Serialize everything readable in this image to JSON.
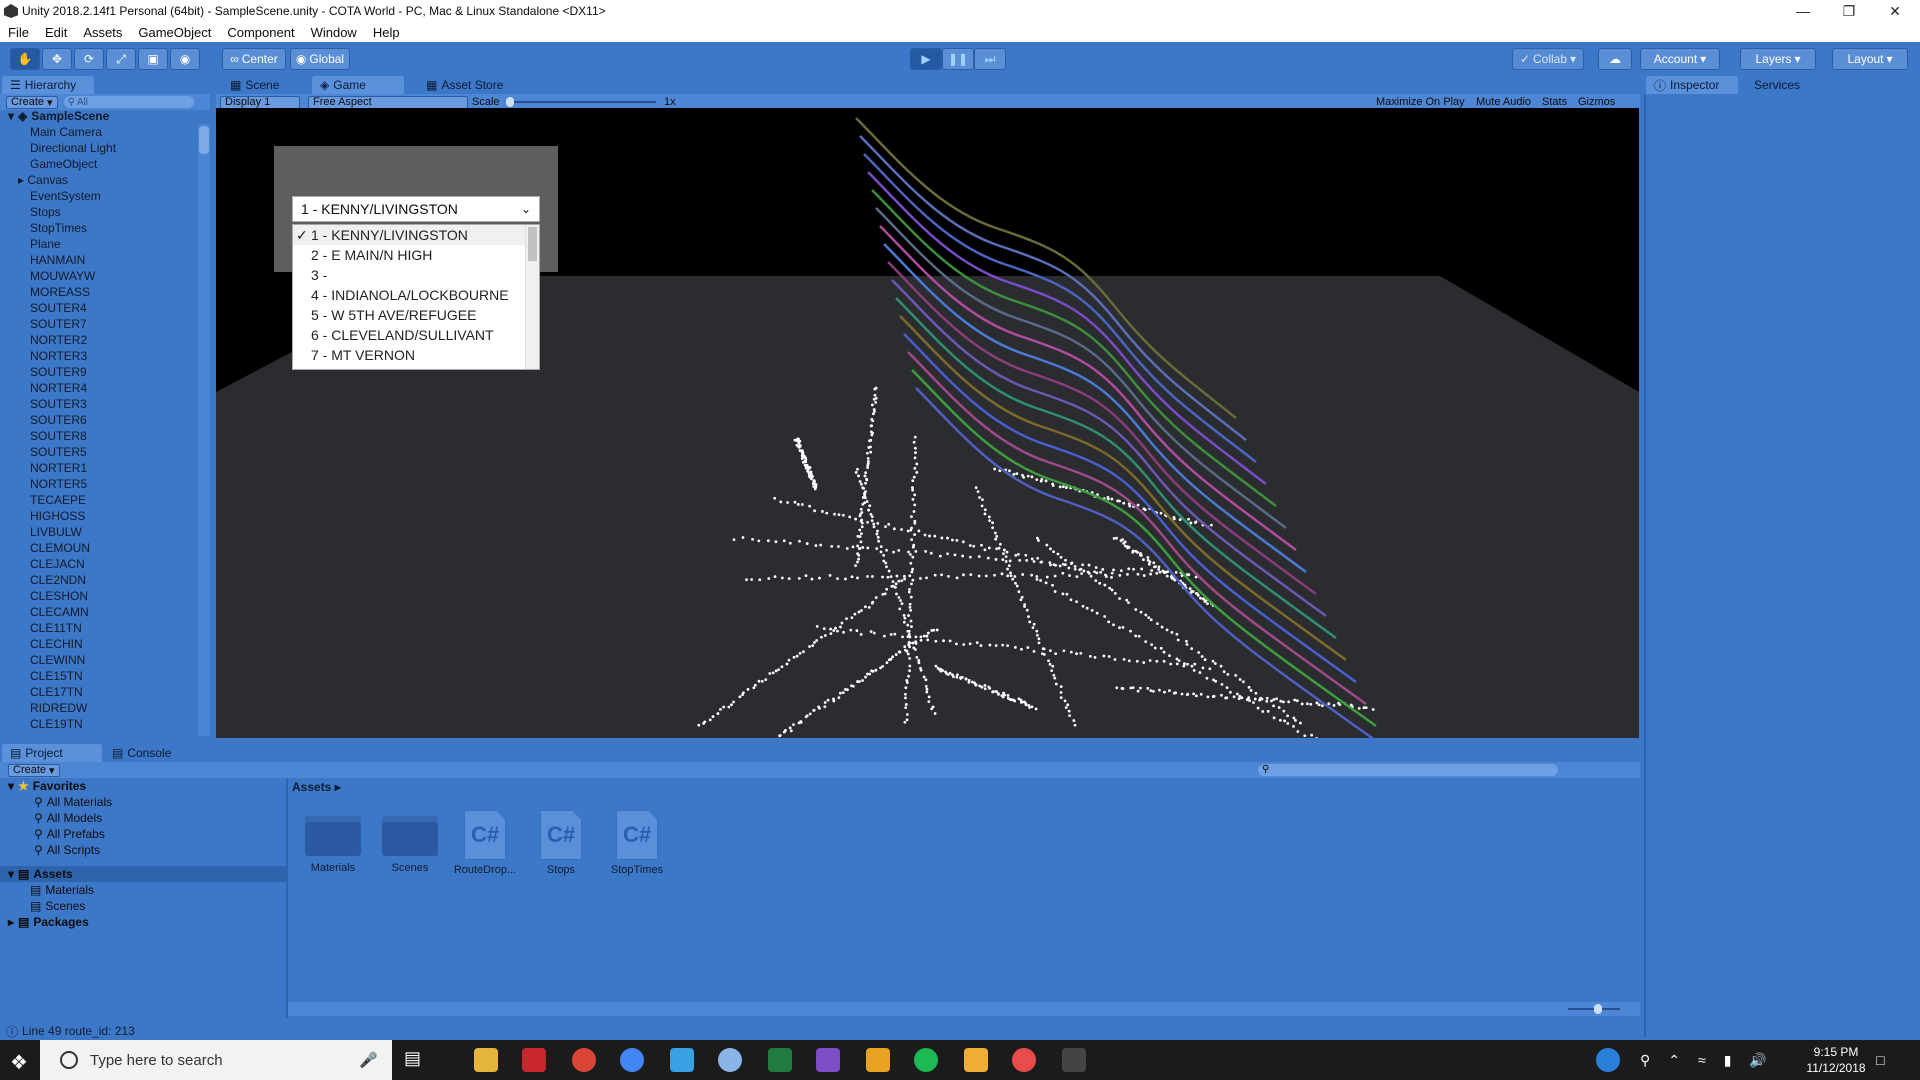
{
  "window": {
    "title": "Unity 2018.2.14f1 Personal (64bit) - SampleScene.unity - COTA World - PC, Mac & Linux Standalone <DX11>"
  },
  "menu": [
    "File",
    "Edit",
    "Assets",
    "GameObject",
    "Component",
    "Window",
    "Help"
  ],
  "toolbar": {
    "center_label": "Center",
    "global_label": "Global",
    "collab_label": "Collab",
    "account_label": "Account",
    "layers_label": "Layers",
    "layout_label": "Layout"
  },
  "hierarchy": {
    "tab": "Hierarchy",
    "create_label": "Create",
    "search_placeholder": "All",
    "scene": "SampleScene",
    "items": [
      "Main Camera",
      "Directional Light",
      "GameObject",
      "Canvas",
      "EventSystem",
      "Stops",
      "StopTimes",
      "Plane",
      "HANMAIN",
      "MOUWAYW",
      "MOREASS",
      "SOUTER4",
      "SOUTER7",
      "NORTER2",
      "NORTER3",
      "SOUTER9",
      "NORTER4",
      "SOUTER3",
      "SOUTER6",
      "SOUTER8",
      "SOUTER5",
      "NORTER1",
      "NORTER5",
      "TECAEPE",
      "HIGHOSS",
      "LIVBULW",
      "CLEMOUN",
      "CLEJACN",
      "CLE2NDN",
      "CLESHON",
      "CLECAMN",
      "CLE11TN",
      "CLECHIN",
      "CLEWINN",
      "CLE15TN",
      "CLE17TN",
      "RIDREDW",
      "CLE19TN"
    ]
  },
  "center_tabs": {
    "scene": "Scene",
    "game": "Game",
    "asset_store": "Asset Store"
  },
  "game_bar": {
    "display": "Display 1",
    "aspect": "Free Aspect",
    "scale_label": "Scale",
    "scale_value": "1x",
    "maximize": "Maximize On Play",
    "mute": "Mute Audio",
    "stats": "Stats",
    "gizmos": "Gizmos"
  },
  "route_dropdown": {
    "selected": "1 - KENNY/LIVINGSTON",
    "options": [
      "1 - KENNY/LIVINGSTON",
      "2 - E MAIN/N HIGH",
      "3 -",
      "4 - INDIANOLA/LOCKBOURNE",
      "5 - W 5TH AVE/REFUGEE",
      "6 - CLEVELAND/SULLIVANT",
      "7 - MT VERNON"
    ]
  },
  "right_tabs": {
    "inspector": "Inspector",
    "services": "Services"
  },
  "project": {
    "tab": "Project",
    "console_tab": "Console",
    "create_label": "Create",
    "favorites": "Favorites",
    "favorite_items": [
      "All Materials",
      "All Models",
      "All Prefabs",
      "All Scripts"
    ],
    "assets_root": "Assets",
    "asset_folders": [
      "Materials",
      "Scenes"
    ],
    "packages": "Packages",
    "breadcrumb": "Assets",
    "assets": [
      {
        "name": "Materials",
        "kind": "folder"
      },
      {
        "name": "Scenes",
        "kind": "folder"
      },
      {
        "name": "RouteDrop...",
        "kind": "script"
      },
      {
        "name": "Stops",
        "kind": "script"
      },
      {
        "name": "StopTimes",
        "kind": "script"
      }
    ],
    "script_glyph": "C#"
  },
  "status_bar": {
    "message": "Line 49 route_id: 213"
  },
  "taskbar": {
    "search_placeholder": "Type here to search",
    "time": "9:15 PM",
    "date": "11/12/2018"
  },
  "colors": {
    "editor_bg": "#3d78c8",
    "game_bg": "#1f2022"
  }
}
